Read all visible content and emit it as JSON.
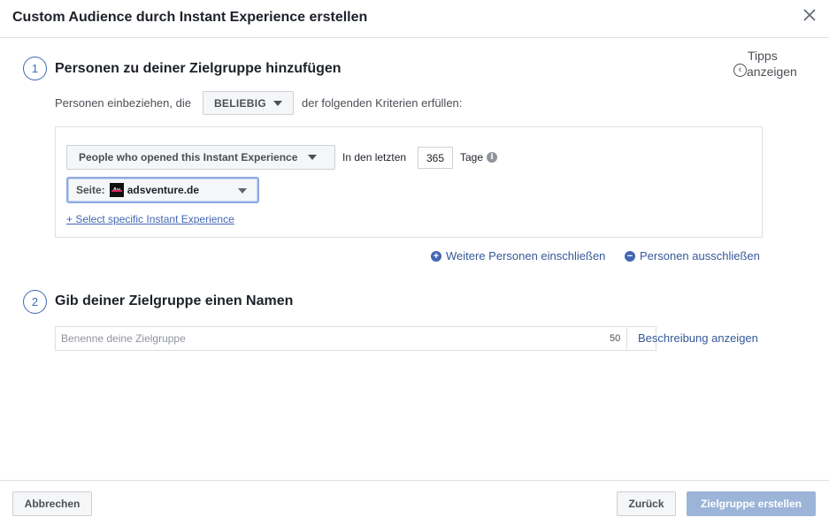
{
  "dialog": {
    "title": "Custom Audience durch Instant Experience erstellen",
    "close_icon": "close-icon"
  },
  "tips": {
    "line1": "Tipps",
    "line2": "anzeigen",
    "arrow": "‹"
  },
  "step1": {
    "number": "1",
    "title": "Personen zu deiner Zielgruppe hinzufügen",
    "criteria_prefix": "Personen einbeziehen, die",
    "criteria_value": "BELIEBIG",
    "criteria_suffix": "der folgenden Kriterien erfüllen:",
    "rule": {
      "event_label": "People who opened this Instant Experience",
      "in_last_label": "In den letzten",
      "days": "365",
      "days_unit": "Tage",
      "info_icon": "i",
      "page_prefix": "Seite:",
      "page_logo_text": "Av",
      "page_name": "adsventure.de",
      "select_specific_link": "+ Select specific Instant Experience"
    },
    "include_more": {
      "icon": "+",
      "label": "Weitere Personen einschließen"
    },
    "exclude": {
      "icon": "−",
      "label": "Personen ausschließen"
    }
  },
  "step2": {
    "number": "2",
    "title": "Gib deiner Zielgruppe einen Namen",
    "name_placeholder": "Benenne deine Zielgruppe",
    "name_value": "",
    "char_count": "50",
    "description_link": "Beschreibung anzeigen"
  },
  "footer": {
    "cancel_label": "Abbrechen",
    "back_label": "Zurück",
    "create_label": "Zielgruppe erstellen"
  },
  "colors": {
    "accent": "#4267b2",
    "link": "#365899",
    "primary_disabled": "#9cb4d8",
    "border": "#dddfe2"
  }
}
